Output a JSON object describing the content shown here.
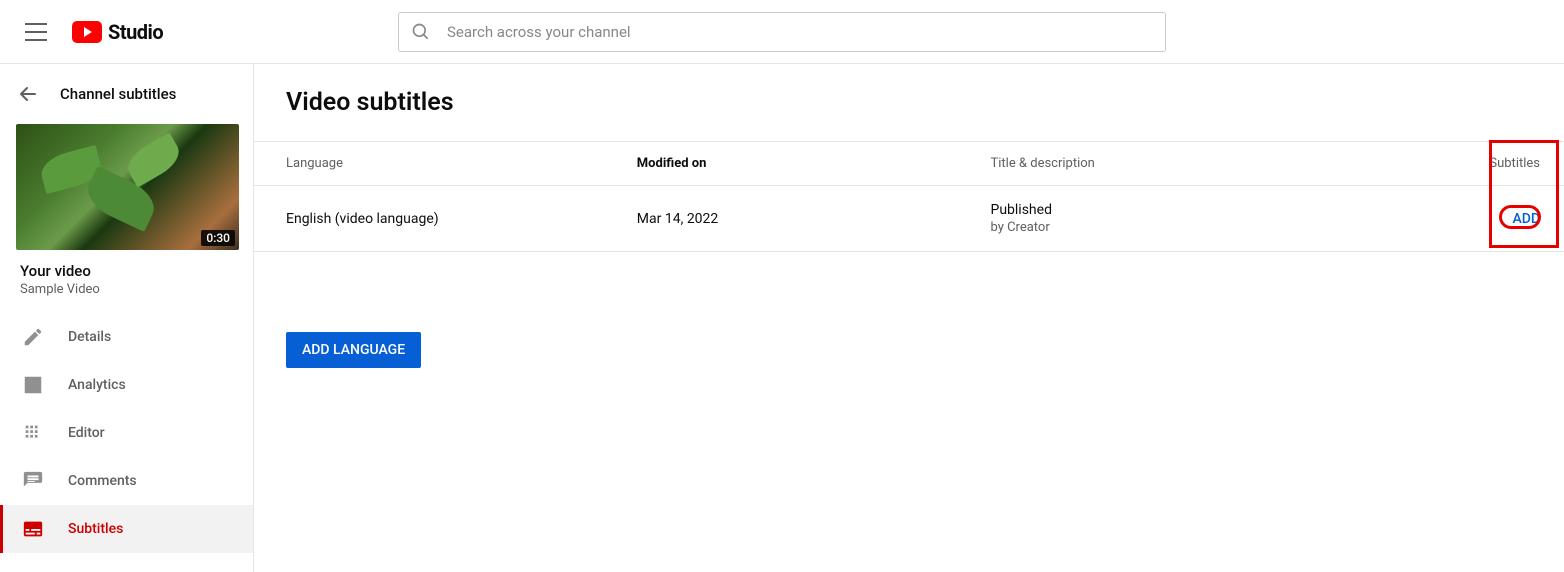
{
  "header": {
    "brand": "Studio",
    "search_placeholder": "Search across your channel"
  },
  "sidebar": {
    "back_label": "Channel subtitles",
    "video": {
      "duration": "0:30",
      "title_label": "Your video",
      "title": "Sample Video"
    },
    "items": [
      {
        "icon": "pencil",
        "label": "Details"
      },
      {
        "icon": "analytics",
        "label": "Analytics"
      },
      {
        "icon": "editor",
        "label": "Editor"
      },
      {
        "icon": "comments",
        "label": "Comments"
      },
      {
        "icon": "subtitles",
        "label": "Subtitles"
      }
    ]
  },
  "main": {
    "title": "Video subtitles",
    "columns": {
      "language": "Language",
      "modified": "Modified on",
      "title_desc": "Title & description",
      "subtitles": "Subtitles"
    },
    "rows": [
      {
        "language": "English (video language)",
        "modified": "Mar 14, 2022",
        "status": "Published",
        "by": "by Creator",
        "action": "ADD"
      }
    ],
    "add_language": "ADD LANGUAGE"
  }
}
